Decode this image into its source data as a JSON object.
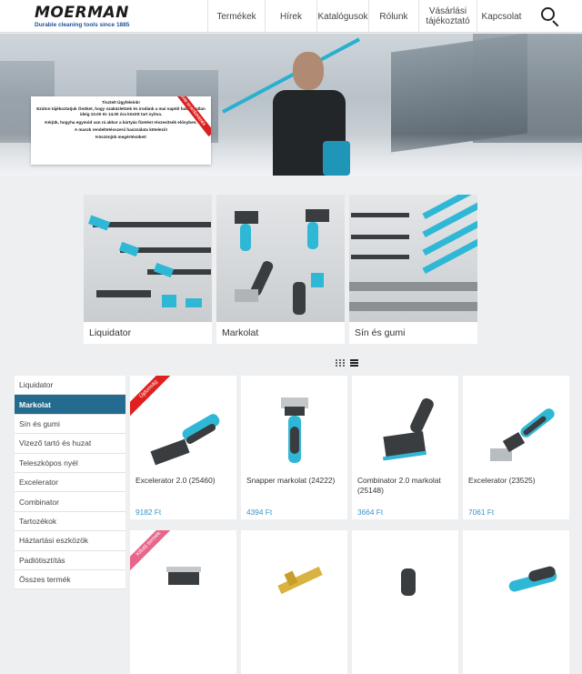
{
  "brand": {
    "logo_text": "MOERMAN",
    "tagline": "Durable cleaning tools since 1885",
    "accent": "#2ab0cf",
    "nav_active_bg": "#246b8f",
    "price_color": "#3694c6"
  },
  "nav": {
    "items": [
      {
        "label": "Termékek"
      },
      {
        "label": "Hírek"
      },
      {
        "label": "Katalógusok"
      },
      {
        "label": "Rólunk"
      },
      {
        "label": "Vásárlási tájékoztató"
      },
      {
        "label": "Kapcsolat"
      }
    ],
    "search_icon": "search-icon"
  },
  "notice": {
    "badge": "COVID-19 INTÉZKEDÉS",
    "lines": [
      "Tisztelt Ügyfeleink!",
      "Ezúton tájékoztatjuk Önöket, hogy szaküzletünk és irodánk a mai naptól határozatlan ideig 10.00 és 14.00 óra között tart nyitva.",
      "Kérjük, hogyha egymód van rá akkor a kártyás fizetést részesítsék előnyben.",
      "A maszk rendeltetésszerű használata kötelező!",
      "Köszönjük megértésüket!"
    ]
  },
  "categories": [
    {
      "label": "Liquidator"
    },
    {
      "label": "Markolat"
    },
    {
      "label": "Sín és gumi"
    }
  ],
  "view_toggle": {
    "grid_icon": "grid-view-icon",
    "list_icon": "list-view-icon"
  },
  "sidebar": {
    "items": [
      {
        "label": "Liquidator"
      },
      {
        "label": "Markolat"
      },
      {
        "label": "Sín és gumi"
      },
      {
        "label": "Vizező tartó és huzat"
      },
      {
        "label": "Teleszkópos nyél"
      },
      {
        "label": "Excelerator"
      },
      {
        "label": "Combinator"
      },
      {
        "label": "Tartozékok"
      },
      {
        "label": "Háztartási eszközök"
      },
      {
        "label": "Padlótisztítás"
      },
      {
        "label": "Összes termék"
      }
    ],
    "active": "Markolat"
  },
  "products": [
    {
      "name": "Excelerator 2.0 (25460)",
      "price": "9182 Ft",
      "ribbon": "Újdonság"
    },
    {
      "name": "Snapper markolat (24222)",
      "price": "4394 Ft",
      "ribbon": ""
    },
    {
      "name": "Combinator 2.0 markolat (25148)",
      "price": "3664 Ft",
      "ribbon": ""
    },
    {
      "name": "Excelerator (23525)",
      "price": "7061 Ft",
      "ribbon": ""
    },
    {
      "name": "",
      "price": "",
      "ribbon": "Kifutó termék"
    },
    {
      "name": "",
      "price": "",
      "ribbon": ""
    },
    {
      "name": "",
      "price": "",
      "ribbon": ""
    },
    {
      "name": "",
      "price": "",
      "ribbon": ""
    }
  ]
}
